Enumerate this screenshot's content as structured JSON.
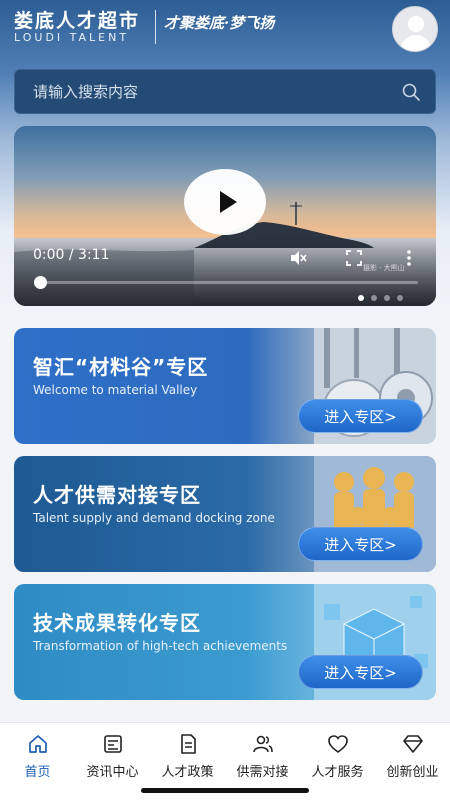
{
  "header": {
    "logo_cn": "娄底人才超市",
    "logo_en": "LOUDI TALENT",
    "slogan": "才聚娄底·梦飞扬"
  },
  "search": {
    "placeholder": "请输入搜索内容"
  },
  "video": {
    "time": "0:00 / 3:11",
    "progress": 0.02,
    "watermark": "摄影 · 大熊山",
    "slides": 4,
    "active_slide": 0
  },
  "zones": [
    {
      "title": "智汇“材料谷”专区",
      "subtitle": "Welcome to material Valley",
      "button": "进入专区>"
    },
    {
      "title": "人才供需对接专区",
      "subtitle": "Talent supply and demand docking zone",
      "button": "进入专区>"
    },
    {
      "title": "技术成果转化专区",
      "subtitle": "Transformation of high-tech achievements",
      "button": "进入专区>"
    }
  ],
  "tabs": [
    {
      "label": "首页",
      "icon": "home-icon",
      "active": true
    },
    {
      "label": "资讯中心",
      "icon": "news-icon",
      "active": false
    },
    {
      "label": "人才政策",
      "icon": "policy-icon",
      "active": false
    },
    {
      "label": "供需对接",
      "icon": "people-icon",
      "active": false
    },
    {
      "label": "人才服务",
      "icon": "heart-icon",
      "active": false
    },
    {
      "label": "创新创业",
      "icon": "diamond-icon",
      "active": false
    }
  ],
  "colors": {
    "accent": "#1f5fb0",
    "header_bg": "#2c5d94"
  }
}
